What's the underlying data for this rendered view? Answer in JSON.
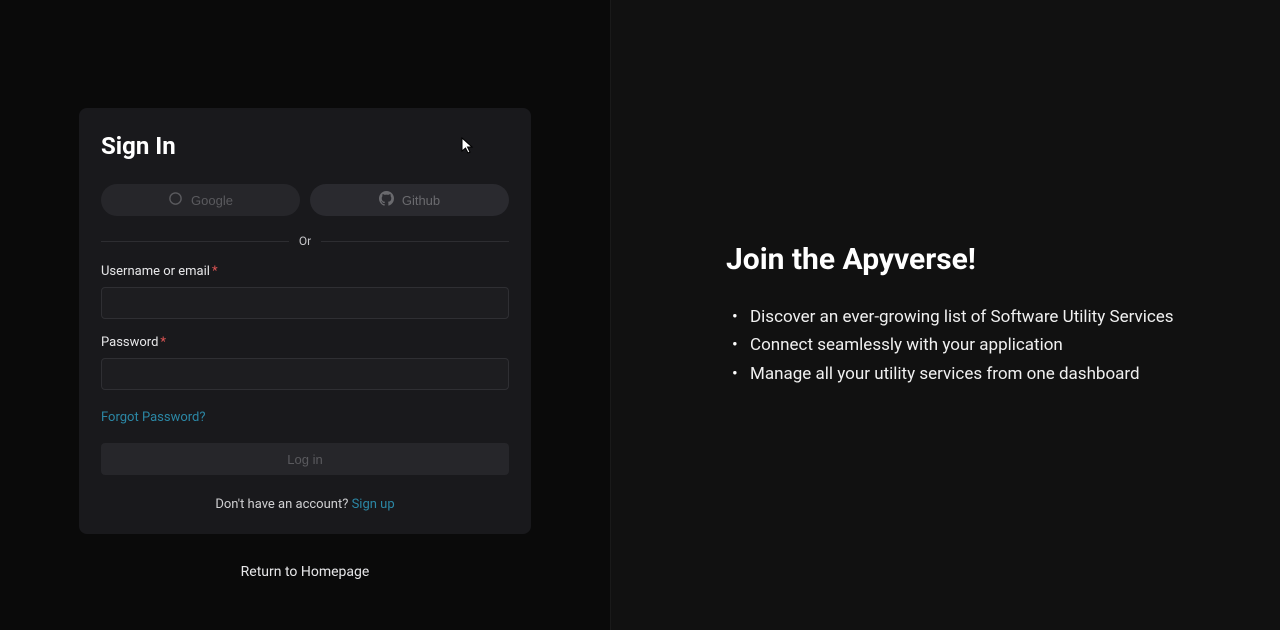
{
  "left": {
    "title": "Sign In",
    "social": {
      "google": "Google",
      "github": "Github"
    },
    "divider": "Or",
    "fields": {
      "username_label": "Username or email",
      "password_label": "Password"
    },
    "forgot": "Forgot Password?",
    "login_button": "Log in",
    "no_account": "Don't have an account? ",
    "signup": "Sign up",
    "return_home": "Return to Homepage"
  },
  "right": {
    "title": "Join the Apyverse!",
    "bullets": [
      "Discover an ever-growing list of Software Utility Services",
      "Connect seamlessly with your application",
      "Manage all your utility services from one dashboard"
    ]
  }
}
